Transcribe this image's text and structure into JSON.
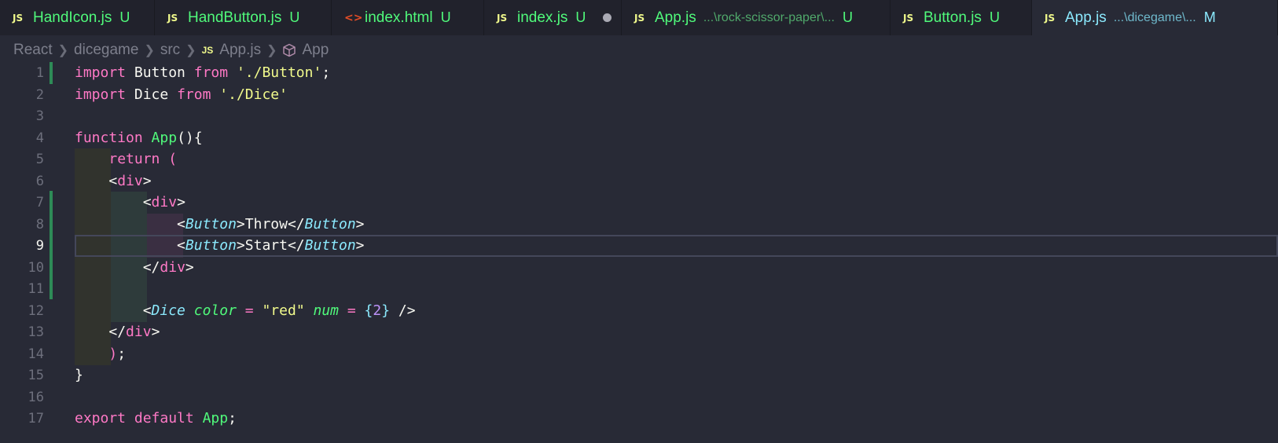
{
  "tabs": [
    {
      "icon": "JS",
      "name": "HandIcon.js",
      "desc": "",
      "status": "U",
      "dirty": false,
      "active": false
    },
    {
      "icon": "JS",
      "name": "HandButton.js",
      "desc": "",
      "status": "U",
      "dirty": false,
      "active": false
    },
    {
      "icon": "<>",
      "name": "index.html",
      "desc": "",
      "status": "U",
      "dirty": false,
      "active": false
    },
    {
      "icon": "JS",
      "name": "index.js",
      "desc": "",
      "status": "U",
      "dirty": true,
      "active": false
    },
    {
      "icon": "JS",
      "name": "App.js",
      "desc": "...\\rock-scissor-paper\\...",
      "status": "U",
      "dirty": false,
      "active": false
    },
    {
      "icon": "JS",
      "name": "Button.js",
      "desc": "",
      "status": "U",
      "dirty": false,
      "active": false
    },
    {
      "icon": "JS",
      "name": "App.js",
      "desc": "...\\dicegame\\...",
      "status": "M",
      "dirty": false,
      "active": true
    }
  ],
  "breadcrumb": {
    "items": [
      "React",
      "dicegame",
      "src",
      "App.js",
      "App"
    ],
    "file_icon": "JS"
  },
  "editor": {
    "current_line": 9,
    "lines": [
      {
        "n": "1",
        "tokens": [
          [
            "kw",
            "import"
          ],
          [
            "id",
            " Button "
          ],
          [
            "kw",
            "from"
          ],
          [
            "id",
            " "
          ],
          [
            "str",
            "'./Button'"
          ],
          [
            "punc",
            ";"
          ]
        ]
      },
      {
        "n": "2",
        "tokens": [
          [
            "kw",
            "import"
          ],
          [
            "id",
            " Dice "
          ],
          [
            "kw",
            "from"
          ],
          [
            "id",
            " "
          ],
          [
            "str",
            "'./Dice'"
          ]
        ]
      },
      {
        "n": "3",
        "tokens": []
      },
      {
        "n": "4",
        "tokens": [
          [
            "kw",
            "function"
          ],
          [
            "id",
            " "
          ],
          [
            "fn",
            "App"
          ],
          [
            "punc",
            "(){"
          ]
        ]
      },
      {
        "n": "5",
        "tokens": [
          [
            "id",
            "    "
          ],
          [
            "kw",
            "return"
          ],
          [
            "id",
            " "
          ],
          [
            "paren",
            "("
          ]
        ]
      },
      {
        "n": "6",
        "tokens": [
          [
            "id",
            "    "
          ],
          [
            "punc",
            "<"
          ],
          [
            "tag",
            "div"
          ],
          [
            "punc",
            ">"
          ]
        ]
      },
      {
        "n": "7",
        "tokens": [
          [
            "id",
            "        "
          ],
          [
            "punc",
            "<"
          ],
          [
            "tag",
            "div"
          ],
          [
            "punc",
            ">"
          ]
        ]
      },
      {
        "n": "8",
        "tokens": [
          [
            "id",
            "            "
          ],
          [
            "punc",
            "<"
          ],
          [
            "comp",
            "Button"
          ],
          [
            "punc",
            ">"
          ],
          [
            "id",
            "Throw"
          ],
          [
            "punc",
            "</"
          ],
          [
            "comp",
            "Button"
          ],
          [
            "punc",
            ">"
          ]
        ]
      },
      {
        "n": "9",
        "tokens": [
          [
            "id",
            "            "
          ],
          [
            "punc",
            "<"
          ],
          [
            "comp",
            "Button"
          ],
          [
            "punc",
            ">"
          ],
          [
            "id",
            "Start"
          ],
          [
            "punc",
            "</"
          ],
          [
            "comp",
            "Button"
          ],
          [
            "punc",
            ">"
          ]
        ]
      },
      {
        "n": "10",
        "tokens": [
          [
            "id",
            "        "
          ],
          [
            "punc",
            "</"
          ],
          [
            "tag",
            "div"
          ],
          [
            "punc",
            ">"
          ]
        ]
      },
      {
        "n": "11",
        "tokens": []
      },
      {
        "n": "12",
        "tokens": [
          [
            "id",
            "        "
          ],
          [
            "punc",
            "<"
          ],
          [
            "comp",
            "Dice"
          ],
          [
            "id",
            " "
          ],
          [
            "attr",
            "color"
          ],
          [
            "id",
            " "
          ],
          [
            "kw",
            "="
          ],
          [
            "id",
            " "
          ],
          [
            "str",
            "\"red\""
          ],
          [
            "id",
            " "
          ],
          [
            "attr",
            "num"
          ],
          [
            "id",
            " "
          ],
          [
            "kw",
            "="
          ],
          [
            "id",
            " "
          ],
          [
            "brace",
            "{"
          ],
          [
            "num",
            "2"
          ],
          [
            "brace",
            "}"
          ],
          [
            "id",
            " "
          ],
          [
            "punc",
            "/>"
          ]
        ]
      },
      {
        "n": "13",
        "tokens": [
          [
            "id",
            "    "
          ],
          [
            "punc",
            "</"
          ],
          [
            "tag",
            "div"
          ],
          [
            "punc",
            ">"
          ]
        ]
      },
      {
        "n": "14",
        "tokens": [
          [
            "id",
            "    "
          ],
          [
            "paren",
            ")"
          ],
          [
            "punc",
            ";"
          ]
        ]
      },
      {
        "n": "15",
        "tokens": [
          [
            "punc",
            "}"
          ]
        ]
      },
      {
        "n": "16",
        "tokens": []
      },
      {
        "n": "17",
        "tokens": [
          [
            "kw",
            "export"
          ],
          [
            "id",
            " "
          ],
          [
            "kw",
            "default"
          ],
          [
            "id",
            " "
          ],
          [
            "fn",
            "App"
          ],
          [
            "punc",
            ";"
          ]
        ]
      }
    ]
  },
  "colors": {
    "background": "#282a36",
    "keyword": "#ff79c6",
    "function": "#50fa7b",
    "string": "#f1fa8c",
    "component": "#8be9fd",
    "number": "#bd93f9",
    "git_added": "#2e8b57"
  }
}
